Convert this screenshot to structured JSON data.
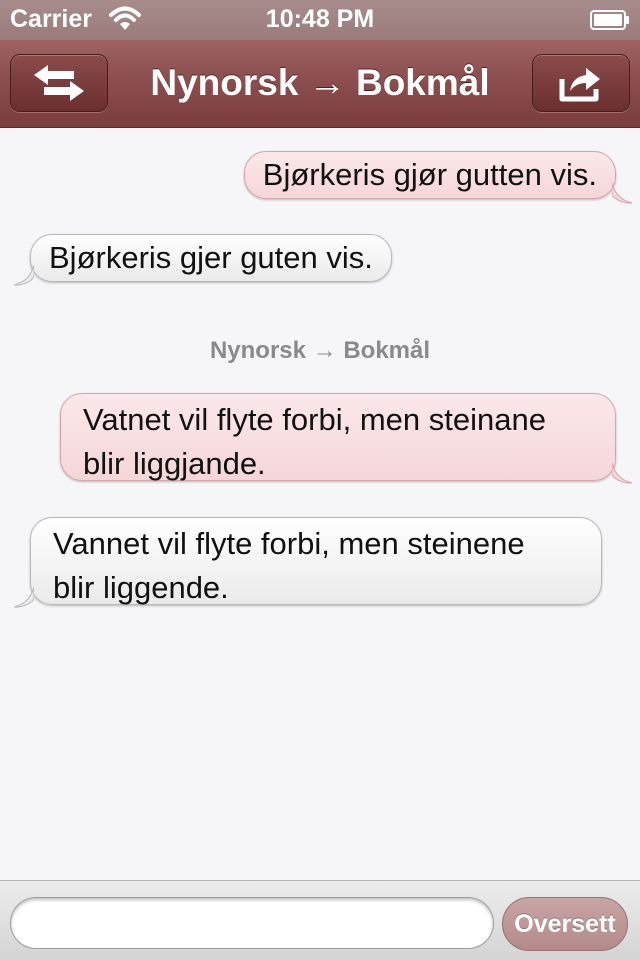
{
  "status": {
    "carrier": "Carrier",
    "time": "10:48 PM"
  },
  "nav": {
    "title": "Nynorsk → Bokmål",
    "left_icon": "swap-arrows-icon",
    "right_icon": "share-icon"
  },
  "messages": [
    {
      "direction": "out",
      "lines": [
        "Bjørkeris gjør gutten vis."
      ]
    },
    {
      "direction": "in",
      "lines": [
        "Bjørkeris gjer guten vis."
      ]
    },
    {
      "direction": "out",
      "lines": [
        "Vatnet vil flyte forbi, men steinane",
        "blir liggjande."
      ]
    },
    {
      "direction": "in",
      "lines": [
        "Vannet vil flyte forbi, men steinene",
        "blir liggende."
      ]
    }
  ],
  "section_label": "Nynorsk → Bokmål",
  "composer": {
    "value": "",
    "send_label": "Oversett"
  },
  "colors": {
    "nav": "#8a4c4c",
    "outgoing": "#f5d6d9",
    "incoming": "#ececec",
    "background": "#f6f6f8"
  }
}
